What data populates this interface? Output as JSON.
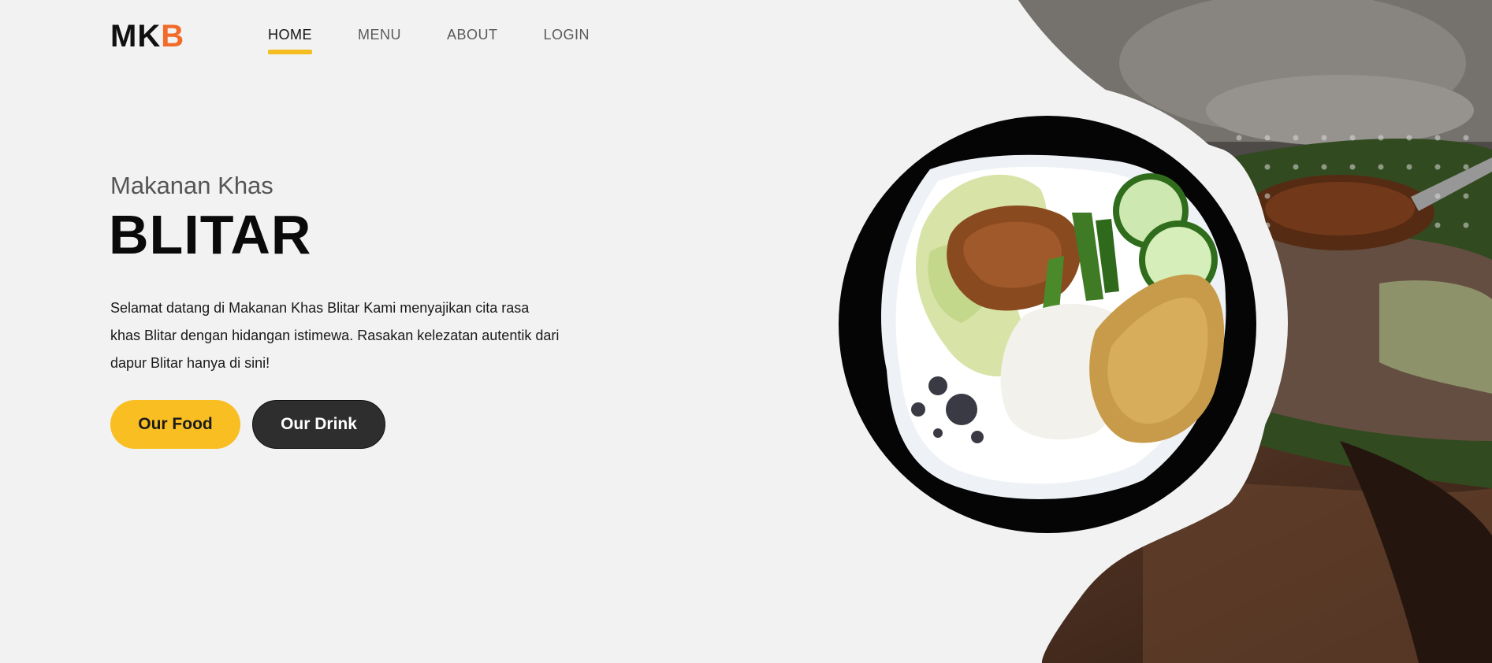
{
  "logo": {
    "main": "MK",
    "accent": "B"
  },
  "nav": {
    "items": [
      {
        "label": "HOME",
        "active": true
      },
      {
        "label": "MENU",
        "active": false
      },
      {
        "label": "ABOUT",
        "active": false
      },
      {
        "label": "LOGIN",
        "active": false
      }
    ]
  },
  "hero": {
    "subtitle": "Makanan Khas",
    "title": "BLITAR",
    "description": "Selamat datang di Makanan Khas Blitar Kami menyajikan cita rasa khas Blitar dengan hidangan istimewa. Rasakan kelezatan autentik dari dapur Blitar hanya di sini!",
    "buttons": {
      "food": "Our Food",
      "drink": "Our Drink"
    }
  },
  "colors": {
    "accent": "#f9be21",
    "logo_accent": "#f26b2a",
    "dark_button": "#2e2e2e",
    "background": "#f1f2f1"
  },
  "images": {
    "plate": "pecel-plate-image",
    "background_photo": "pecel-preparation-photo"
  }
}
